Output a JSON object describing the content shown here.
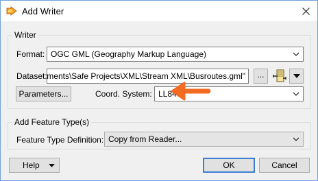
{
  "dialog": {
    "title": "Add Writer"
  },
  "writer_group": {
    "label": "Writer",
    "format_label": "Format:",
    "format_value": "OGC GML (Geography Markup Language)",
    "dataset_label": "Dataset:",
    "dataset_value": "ments\\Safe Projects\\XML\\Stream XML\\Busroutes.gml\"",
    "browse_label": "...",
    "parameters_label": "Parameters...",
    "coord_label": "Coord. System:",
    "coord_value": "LL84"
  },
  "feature_group": {
    "label": "Add Feature Type(s)",
    "def_label": "Feature Type Definition:",
    "def_value": "Copy from Reader..."
  },
  "buttons": {
    "help": "Help",
    "ok": "OK",
    "cancel": "Cancel"
  },
  "colors": {
    "accent_arrow": "#f26b22",
    "focus_border": "#3c7fd1",
    "dialog_bg": "#f0f0f0"
  }
}
